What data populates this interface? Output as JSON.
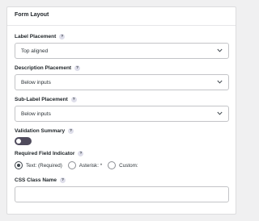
{
  "panel": {
    "title": "Form Layout"
  },
  "help_icon_glyph": "?",
  "fields": {
    "label_placement": {
      "label": "Label Placement",
      "value": "Top aligned"
    },
    "description_placement": {
      "label": "Description Placement",
      "value": "Below inputs"
    },
    "sublabel_placement": {
      "label": "Sub-Label Placement",
      "value": "Below inputs"
    },
    "validation_summary": {
      "label": "Validation Summary",
      "enabled": false
    },
    "required_indicator": {
      "label": "Required Field Indicator",
      "options": [
        "Text: (Required)",
        "Asterisk: *",
        "Custom:"
      ],
      "selected": "Text: (Required)"
    },
    "css_class_name": {
      "label": "CSS Class Name",
      "value": ""
    }
  },
  "colors": {
    "toggle_off": "#4f4b5c",
    "border": "#c3c4c7",
    "background": "#f0f0f1"
  }
}
